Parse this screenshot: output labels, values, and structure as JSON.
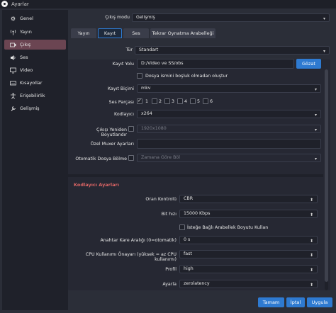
{
  "window": {
    "title": "Ayarlar"
  },
  "sidebar": {
    "items": [
      {
        "label": "Genel",
        "icon": "gear-icon"
      },
      {
        "label": "Yayın",
        "icon": "broadcast-icon"
      },
      {
        "label": "Çıkış",
        "icon": "output-icon"
      },
      {
        "label": "Ses",
        "icon": "speaker-icon"
      },
      {
        "label": "Video",
        "icon": "monitor-icon"
      },
      {
        "label": "Kısayollar",
        "icon": "keyboard-icon"
      },
      {
        "label": "Erişebilirlik",
        "icon": "accessibility-icon"
      },
      {
        "label": "Gelişmiş",
        "icon": "wrench-icon"
      }
    ],
    "active_index": 2
  },
  "output_mode": {
    "label": "Çıkış modu",
    "value": "Gelişmiş"
  },
  "tabs": [
    {
      "label": "Yayın"
    },
    {
      "label": "Kayıt"
    },
    {
      "label": "Ses"
    },
    {
      "label": "Tekrar Oynatma Arabelleği"
    }
  ],
  "active_tab": 1,
  "type": {
    "label": "Tür",
    "value": "Standart"
  },
  "recording": {
    "path_label": "Kayıt Yolu",
    "path_value": "D:/Video ve SS/obs",
    "browse_label": "Gözat",
    "no_space_label": "Dosya ismini boşluk olmadan oluştur",
    "format_label": "Kayıt Biçimi",
    "format_value": "mkv",
    "audio_track_label": "Ses Parçası",
    "tracks": [
      "1",
      "2",
      "3",
      "4",
      "5",
      "6"
    ],
    "encoder_label": "Kodlayıcı",
    "encoder_value": "x264",
    "rescale_label": "Çıkışı Yeniden Boyutlandır",
    "rescale_value": "1920x1080",
    "muxer_label": "Özel Muxer Ayarları",
    "split_label": "Otomatik Dosya Bölme",
    "split_value": "Zamana Göre Böl"
  },
  "encoder_settings": {
    "title": "Kodlayıcı Ayarları",
    "rate_control_label": "Oran Kontrolü",
    "rate_control_value": "CBR",
    "bitrate_label": "Bit hızı",
    "bitrate_value": "15000 Kbps",
    "custom_buffer_label": "İsteğe Bağlı Arabellek Boyutu Kullan",
    "keyframe_label": "Anahtar Kare Aralığı (0=otomatik)",
    "keyframe_value": "0 s",
    "cpu_preset_label": "CPU Kullanımı Önayarı (yüksek = az CPU kullanımı)",
    "cpu_preset_value": "fast",
    "profile_label": "Profil",
    "profile_value": "high",
    "tune_label": "Ayarla",
    "tune_value": "zerolatency"
  },
  "footer": {
    "apply_label": "Tamam",
    "cancel_label": "İptal",
    "ok_label": "Uygula"
  },
  "colors": {
    "accent": "#2e7ad1",
    "section_title": "#d96464",
    "sidebar_active": "#6b4552"
  }
}
